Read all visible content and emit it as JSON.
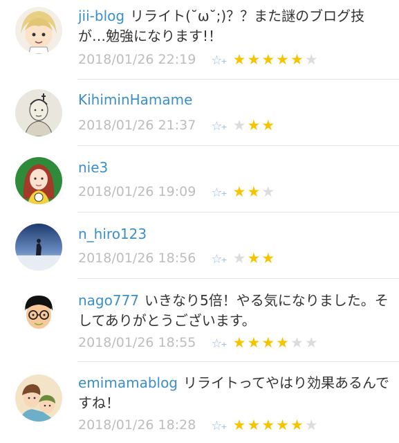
{
  "comments": [
    {
      "user": "jii-blog",
      "text": "リライト(˘ω˘;)？？また謎のブログ技が…勉強になります!！",
      "date": "2018/01/26 22:19",
      "stars_filled": 5,
      "stars_total": 6
    },
    {
      "user": "KihiminHamame",
      "text": "",
      "date": "2018/01/26 21:37",
      "stars_filled": 2,
      "stars_total": 3
    },
    {
      "user": "nie3",
      "text": "",
      "date": "2018/01/26 19:09",
      "stars_filled": 2,
      "stars_total": 3
    },
    {
      "user": "n_hiro123",
      "text": "",
      "date": "2018/01/26 18:56",
      "stars_filled": 2,
      "stars_total": 3
    },
    {
      "user": "nago777",
      "text": "いきなり5倍！やる気になりました。そしてありがとうございます。",
      "date": "2018/01/26 18:55",
      "stars_filled": 4,
      "stars_total": 6
    },
    {
      "user": "emimamablog",
      "text": "リライトってやはり効果あるんですね！",
      "date": "2018/01/26 18:28",
      "stars_filled": 5,
      "stars_total": 6
    }
  ],
  "icons": {
    "add_star": "add-star-icon",
    "star": "star-icon"
  },
  "colors": {
    "username": "#3a8fc9",
    "star_on": "#f5c400",
    "star_off": "#dcdcdc",
    "meta": "#bdbdbd"
  }
}
